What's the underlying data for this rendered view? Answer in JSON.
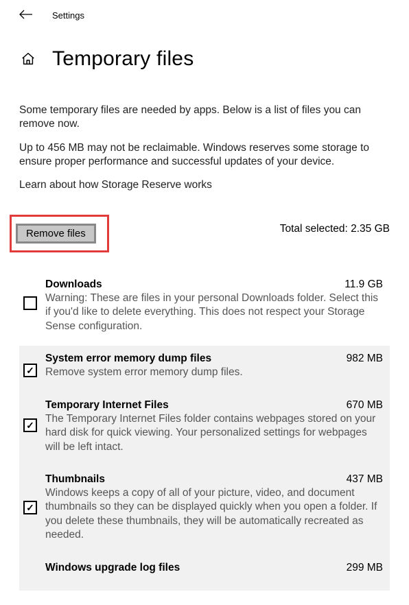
{
  "header": {
    "settings": "Settings"
  },
  "title": "Temporary files",
  "intro": "Some temporary files are needed by apps. Below is a list of files you can remove now.",
  "reserve": "Up to 456 MB may not be reclaimable. Windows reserves some storage to ensure proper performance and successful updates of your device.",
  "learn": "Learn about how Storage Reserve works",
  "remove_label": "Remove files",
  "total_label": "Total selected: 2.35 GB",
  "items": [
    {
      "title": "Downloads",
      "size": "11.9 GB",
      "desc": "Warning: These are files in your personal Downloads folder. Select this if you'd like to delete everything. This does not respect your Storage Sense configuration.",
      "checked": false
    },
    {
      "title": "System error memory dump files",
      "size": "982 MB",
      "desc": "Remove system error memory dump files.",
      "checked": true
    },
    {
      "title": "Temporary Internet Files",
      "size": "670 MB",
      "desc": "The Temporary Internet Files folder contains webpages stored on your hard disk for quick viewing. Your personalized settings for webpages will be left intact.",
      "checked": true
    },
    {
      "title": "Thumbnails",
      "size": "437 MB",
      "desc": "Windows keeps a copy of all of your picture, video, and document thumbnails so they can be displayed quickly when you open a folder. If you delete these thumbnails, they will be automatically recreated as needed.",
      "checked": true
    },
    {
      "title": "Windows upgrade log files",
      "size": "299 MB",
      "desc": "",
      "checked": true
    }
  ]
}
